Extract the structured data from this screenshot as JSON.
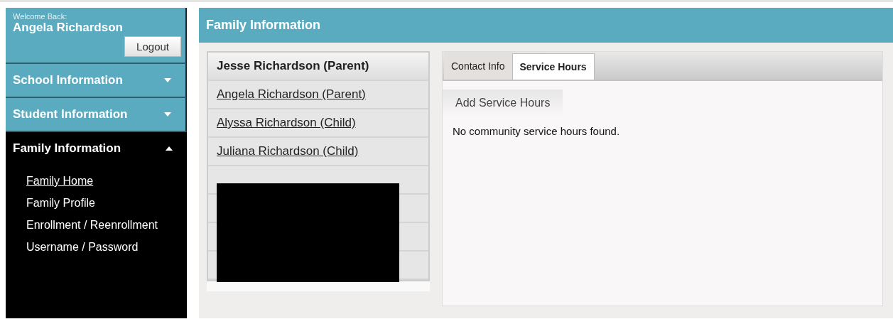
{
  "sidebar": {
    "welcome": "Welcome Back:",
    "user_name": "Angela Richardson",
    "logout_button": "Logout",
    "sections": [
      {
        "label": "School Information",
        "expanded": false
      },
      {
        "label": "Student Information",
        "expanded": false
      },
      {
        "label": "Family Information",
        "expanded": true,
        "children": [
          {
            "label": "Family Home",
            "selected": true
          },
          {
            "label": "Family Profile",
            "selected": false
          },
          {
            "label": "Enrollment / Reenrollment",
            "selected": false
          },
          {
            "label": "Username / Password",
            "selected": false
          }
        ]
      }
    ]
  },
  "header": {
    "title": "Family Information"
  },
  "members": [
    {
      "kind": "person",
      "label": "Jesse Richardson (Parent)",
      "selected": true
    },
    {
      "kind": "person",
      "label": "Angela Richardson (Parent)",
      "selected": false
    },
    {
      "kind": "person",
      "label": "Alyssa Richardson (Child)",
      "selected": false
    },
    {
      "kind": "person",
      "label": "Juliana Richardson (Child)",
      "selected": false
    },
    {
      "kind": "redacted"
    },
    {
      "kind": "redacted"
    },
    {
      "kind": "redacted"
    },
    {
      "kind": "redacted"
    }
  ],
  "tabs": [
    {
      "label": "Contact Info",
      "selected": false
    },
    {
      "label": "Service Hours",
      "selected": true
    }
  ],
  "add_button": "Add Service Hours",
  "message": "No community service hours found."
}
